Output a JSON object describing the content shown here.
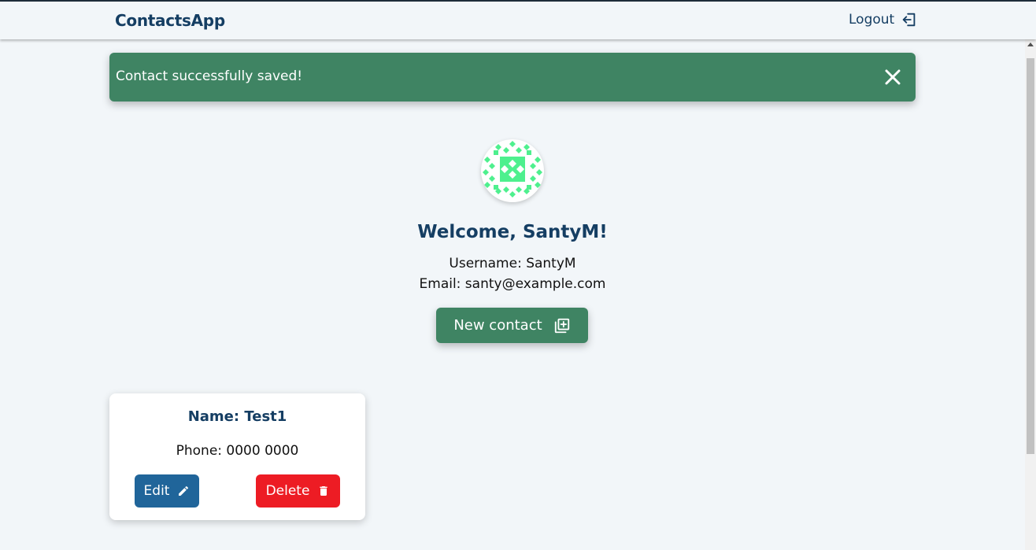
{
  "navbar": {
    "brand": "ContactsApp",
    "logout_label": "Logout",
    "logout_icon": "logout-icon"
  },
  "alert": {
    "message": "Contact successfully saved!",
    "close_icon": "close-icon",
    "color": "#3f8463"
  },
  "profile": {
    "welcome": "Welcome, SantyM!",
    "username_line": "Username: SantyM",
    "email_line": "Email: santy@example.com",
    "avatar_icon": "identicon-avatar"
  },
  "actions": {
    "new_contact_label": "New contact",
    "new_contact_icon": "add-box-icon"
  },
  "contacts": [
    {
      "name_line": "Name: Test1",
      "phone_line": "Phone: 0000 0000",
      "edit_label": "Edit",
      "delete_label": "Delete"
    }
  ],
  "colors": {
    "primary_dark": "#153e63",
    "success": "#3f8463",
    "edit": "#20659a",
    "danger": "#ed1c24",
    "avatar_pattern": "#4ef08e"
  }
}
